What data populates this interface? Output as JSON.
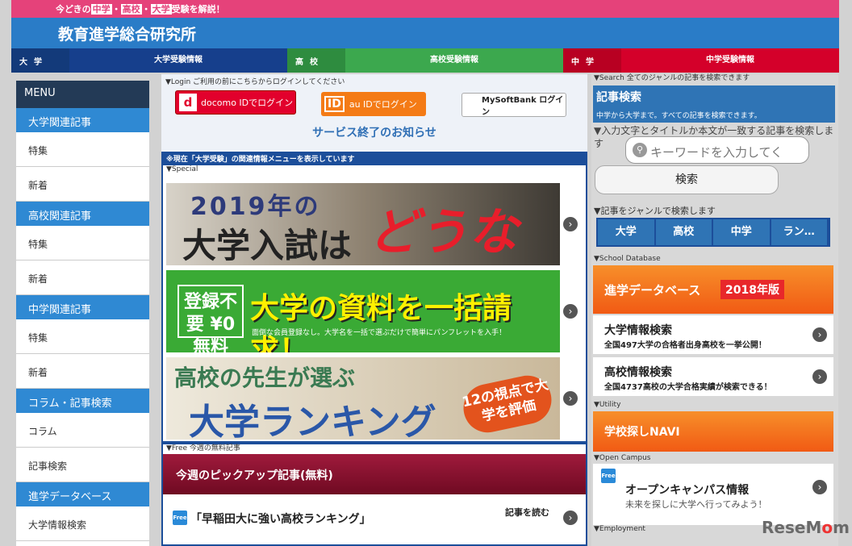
{
  "top": {
    "pre": "今どきの",
    "h1": "中学",
    "dot1": "・",
    "h2": "高校",
    "dot2": "・",
    "h3": "大学",
    "post": "受験を解説！"
  },
  "site_title": "教育進学総合研究所",
  "tabs": [
    {
      "label": "大学",
      "text": "大学受験情報"
    },
    {
      "label": "高校",
      "text": "高校受験情報"
    },
    {
      "label": "中学",
      "text": "中学受験情報"
    }
  ],
  "sidebar": {
    "menu": "MENU",
    "groups": [
      {
        "cat": "大学関連記事",
        "items": [
          "特集",
          "新着"
        ]
      },
      {
        "cat": "高校関連記事",
        "items": [
          "特集",
          "新着"
        ]
      },
      {
        "cat": "中学関連記事",
        "items": [
          "特集",
          "新着"
        ]
      },
      {
        "cat": "コラム・記事検索",
        "items": [
          "コラム",
          "記事検索"
        ]
      },
      {
        "cat": "進学データベース",
        "items": [
          "大学情報検索"
        ]
      }
    ]
  },
  "login": {
    "caption": "▼Login ご利用の前にこちらからログインしてください",
    "docomo_mark": "d",
    "docomo": "docomo IDでログイン",
    "au_mark": "ID",
    "au": "au IDでログイン",
    "softbank": "MySoftBank ログイン"
  },
  "notice": "サービス終了のお知らせ",
  "infobar": "※現在「大学受験」の関連情報メニューを表示しています",
  "special_caption": "▼Special",
  "banners": {
    "b1_line1": "2019年の",
    "b1_line2": "大学入試は",
    "b1_line3": "どうなる？",
    "b2_free": "登録不要 ¥0 無料",
    "b2_main": "大学の資料を一括請求！",
    "b2_sub": "面倒な会員登録なし。大学名を一括で選ぶだけで簡単にパンフレットを入手！",
    "b3_line1": "高校の先生が選ぶ",
    "b3_line2": "大学ランキング",
    "b3_badge": "12の視点で大学を評価"
  },
  "free_caption": "▼Free 今週の無料記事",
  "pickup": "今週のピックアップ記事(無料)",
  "free_icon": "Free",
  "free_article": "「早稲田大に強い高校ランキング」",
  "read_more": "記事を読む",
  "right": {
    "search_caption": "▼Search 全てのジャンルの記事を検索できます",
    "kiji_title": "記事検索",
    "kiji_sub": "中学から大学まで。すべての記事を検索できます。",
    "search_desc": "▼入力文字とタイトルか本文が一致する記事を検索します",
    "search_placeholder": "キーワードを入力してく",
    "search_button": "検索",
    "genre_caption": "▼記事をジャンルで検索します",
    "genres": [
      "大学",
      "高校",
      "中学",
      "ラン…"
    ],
    "db_caption": "▼School Database",
    "db_title": "進学データベース",
    "db_year": "2018年版",
    "univ_title": "大学情報検索",
    "univ_sub": "全国497大学の合格者出身高校を一挙公開！",
    "hs_title": "高校情報検索",
    "hs_sub": "全国4737高校の大学合格実績が検索できる！",
    "utility_caption": "▼Utility",
    "navi": "学校探しNAVI",
    "oc_caption": "▼Open Campus",
    "oc_title": "オープンキャンパス情報",
    "oc_sub": "未来を探しに大学へ行ってみよう！",
    "emp_caption": "▼Employment"
  },
  "watermark": {
    "a": "Rese",
    "b": "M",
    "c": "o",
    "d": "m"
  }
}
